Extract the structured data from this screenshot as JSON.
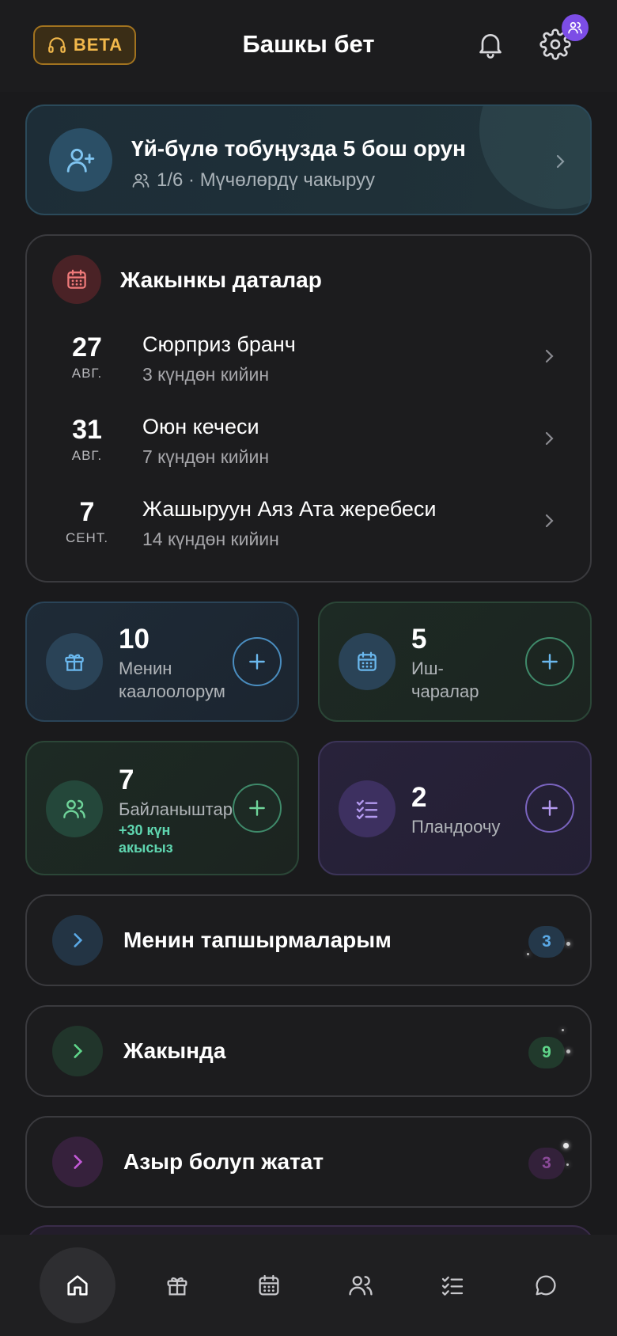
{
  "header": {
    "beta_label": "BETA",
    "title": "Башкы бет"
  },
  "family_banner": {
    "title": "Үй-бүлө тобуңузда 5 бош орун",
    "subtitle": "1/6 · Мүчөлөрдү чакыруу"
  },
  "dates": {
    "title": "Жакынкы даталар",
    "items": [
      {
        "day": "27",
        "month": "АВГ.",
        "name": "Сюрприз бранч",
        "when": "3 күндөн кийин"
      },
      {
        "day": "31",
        "month": "АВГ.",
        "name": "Оюн кечеси",
        "when": "7 күндөн кийин"
      },
      {
        "day": "7",
        "month": "СЕНТ.",
        "name": "Жашыруун Аяз Ата жеребеси",
        "when": "14 күндөн кийин"
      }
    ]
  },
  "tiles": {
    "gifts": {
      "count": "10",
      "label_1": "Менин",
      "label_2": "каалоолорум"
    },
    "events": {
      "count": "5",
      "label_1": "Иш-",
      "label_2": "чаралар"
    },
    "contacts": {
      "count": "7",
      "label": "Байланыштар",
      "extra_1": "+30 күн",
      "extra_2": "акысыз"
    },
    "planner": {
      "count": "2",
      "label": "Пландоочу"
    }
  },
  "lists": [
    {
      "label": "Менин тапшырмаларым",
      "count": "3",
      "color": "#5aa9e6"
    },
    {
      "label": "Жакында",
      "count": "9",
      "color": "#5fd68a"
    },
    {
      "label": "Азыр болуп жатат",
      "count": "3",
      "color": "#c45ad8"
    }
  ],
  "tabbar": {
    "icons": [
      "home-icon",
      "gift-icon",
      "calendar-icon",
      "people-icon",
      "checklist-icon",
      "chat-icon"
    ],
    "active": "home-icon"
  },
  "colors": {
    "accent_beta": "#f2b84b",
    "badge_purple": "#7c4de6",
    "contacts_green": "#5fd6b0"
  }
}
